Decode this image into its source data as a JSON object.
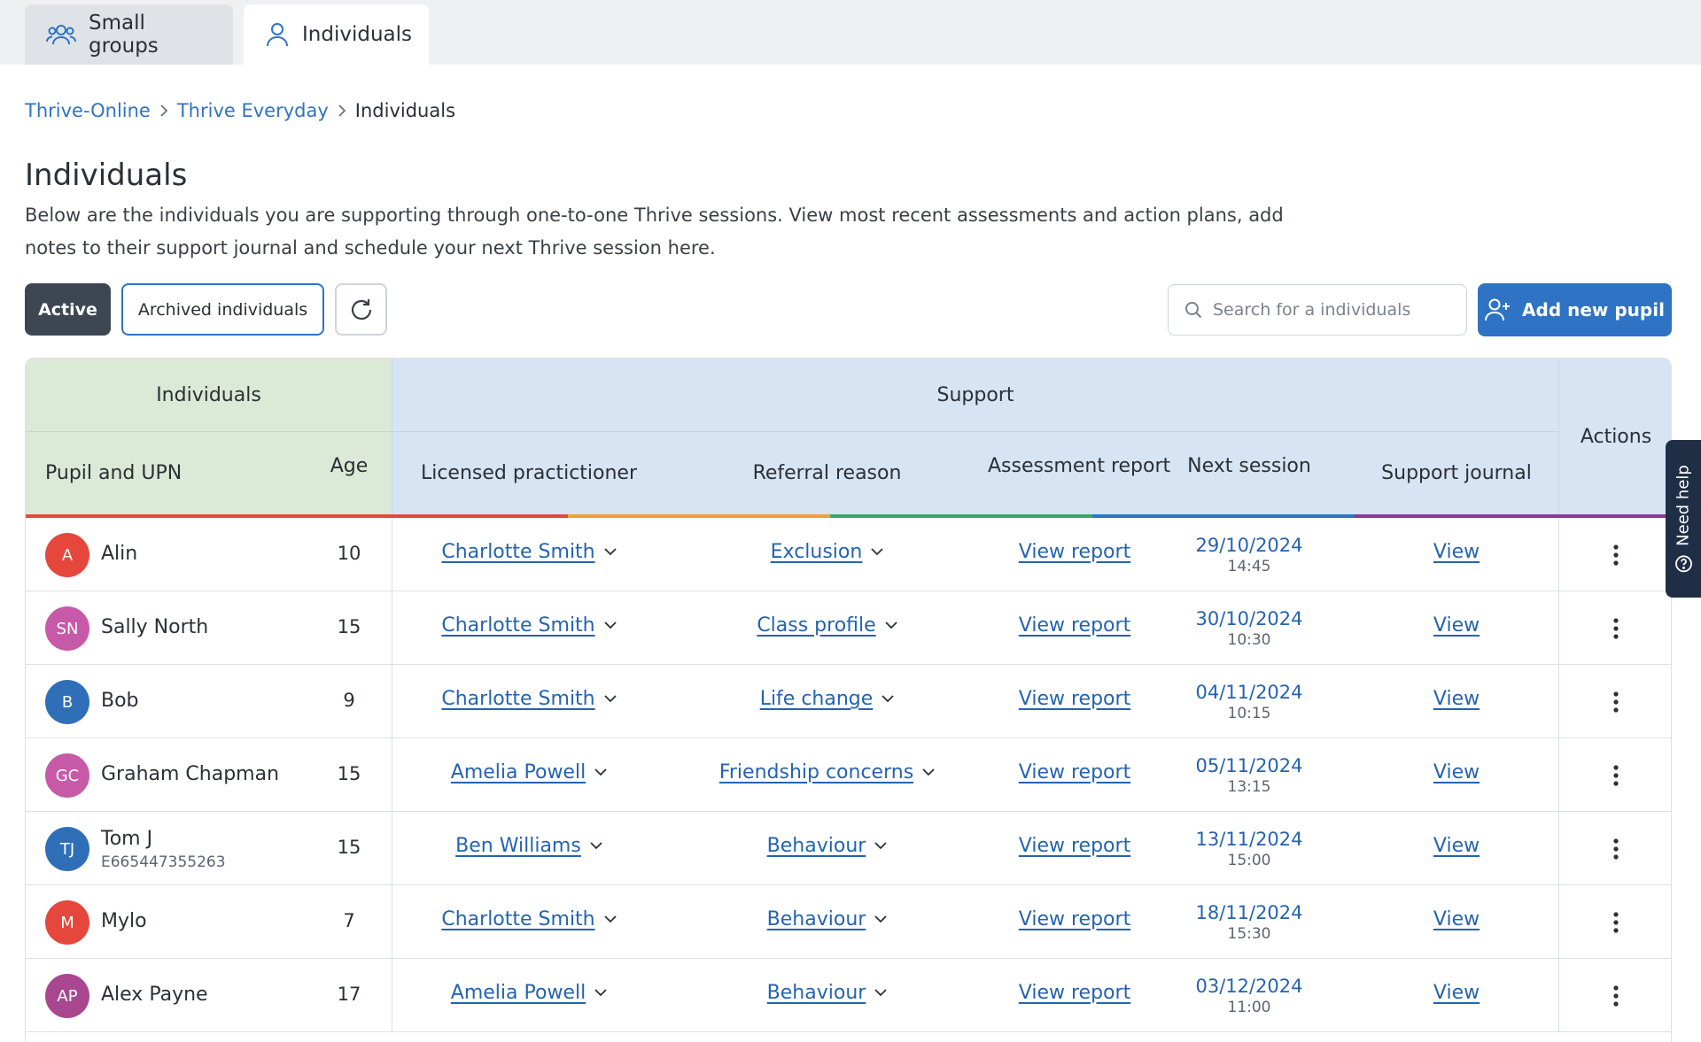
{
  "tabs": [
    {
      "label": "Small groups"
    },
    {
      "label": "Individuals"
    }
  ],
  "breadcrumb": [
    "Thrive-Online",
    "Thrive Everyday",
    "Individuals"
  ],
  "page": {
    "title": "Individuals",
    "description_line1": "Below are the individuals you are supporting through one-to-one Thrive sessions. View most recent assessments and action plans, add",
    "description_line2": "notes to their support journal and schedule your next Thrive session here."
  },
  "filters": {
    "active": "Active",
    "archived": "Archived individuals"
  },
  "search": {
    "placeholder": "Search for a individuals"
  },
  "add_button": "Add new pupil",
  "table": {
    "groups": {
      "individuals": "Individuals",
      "support": "Support",
      "actions": "Actions"
    },
    "columns": {
      "pupil": "Pupil and UPN",
      "age": "Age",
      "practitioner": "Licensed practictioner",
      "referral": "Referral reason",
      "assessment": "Assessment report",
      "next_session": "Next session",
      "journal": "Support journal"
    },
    "rows": [
      {
        "initials": "A",
        "name": "Alin",
        "upn": "",
        "age": "10",
        "practitioner": "Charlotte Smith",
        "referral": "Exclusion",
        "report": "View report",
        "date": "29/10/2024",
        "time": "14:45",
        "journal": "View",
        "color": "#e5473c"
      },
      {
        "initials": "SN",
        "name": "Sally North",
        "upn": "",
        "age": "15",
        "practitioner": "Charlotte Smith",
        "referral": "Class profile",
        "report": "View report",
        "date": "30/10/2024",
        "time": "10:30",
        "journal": "View",
        "color": "#c75aa8"
      },
      {
        "initials": "B",
        "name": "Bob",
        "upn": "",
        "age": "9",
        "practitioner": "Charlotte Smith",
        "referral": "Life change",
        "report": "View report",
        "date": "04/11/2024",
        "time": "10:15",
        "journal": "View",
        "color": "#2f6fb8"
      },
      {
        "initials": "GC",
        "name": "Graham Chapman",
        "upn": "",
        "age": "15",
        "practitioner": "Amelia Powell",
        "referral": "Friendship concerns",
        "report": "View report",
        "date": "05/11/2024",
        "time": "13:15",
        "journal": "View",
        "color": "#c75aa8"
      },
      {
        "initials": "TJ",
        "name": "Tom J",
        "upn": "E665447355263",
        "age": "15",
        "practitioner": "Ben Williams",
        "referral": "Behaviour",
        "report": "View report",
        "date": "13/11/2024",
        "time": "15:00",
        "journal": "View",
        "color": "#2f6fb8"
      },
      {
        "initials": "M",
        "name": "Mylo",
        "upn": "",
        "age": "7",
        "practitioner": "Charlotte Smith",
        "referral": "Behaviour",
        "report": "View report",
        "date": "18/11/2024",
        "time": "15:30",
        "journal": "View",
        "color": "#e5473c"
      },
      {
        "initials": "AP",
        "name": "Alex Payne",
        "upn": "",
        "age": "17",
        "practitioner": "Amelia Powell",
        "referral": "Behaviour",
        "report": "View report",
        "date": "03/12/2024",
        "time": "11:00",
        "journal": "View",
        "color": "#a8478f"
      }
    ]
  },
  "help": {
    "label": "Need help"
  },
  "colors": {
    "accent": "#2f73c4",
    "link": "#2463b0",
    "individuals_header": "#dbe9d6",
    "support_header": "#d6e4f3",
    "stripe": [
      "#e5473c",
      "#f0a030",
      "#3aa56c",
      "#2f73c4",
      "#8a3b97"
    ]
  }
}
